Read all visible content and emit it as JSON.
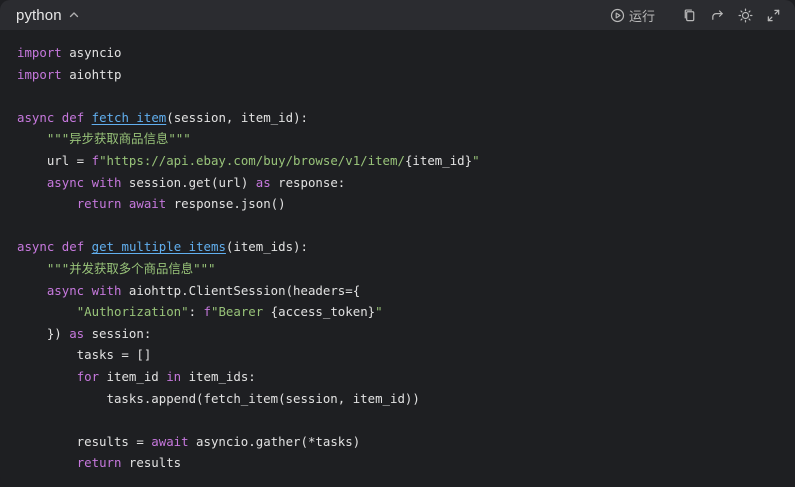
{
  "header": {
    "language": "python",
    "run_label": "运行",
    "icons": [
      "chevron-up-icon",
      "play-circle-icon",
      "copy-icon",
      "redo-arrow-icon",
      "sun-icon",
      "expand-icon"
    ]
  },
  "colors": {
    "background": "#1e1f22",
    "header_background": "#2b2c30",
    "keyword": "#c678dd",
    "function": "#61afef",
    "string": "#98c379",
    "text": "#e2e2e2"
  },
  "code": {
    "lines": [
      [
        {
          "t": "kw",
          "v": "import"
        },
        {
          "t": "plain",
          "v": " asyncio"
        }
      ],
      [
        {
          "t": "kw",
          "v": "import"
        },
        {
          "t": "plain",
          "v": " aiohttp"
        }
      ],
      [],
      [
        {
          "t": "kw",
          "v": "async"
        },
        {
          "t": "plain",
          "v": " "
        },
        {
          "t": "kw",
          "v": "def"
        },
        {
          "t": "plain",
          "v": " "
        },
        {
          "t": "fn",
          "v": "fetch_item"
        },
        {
          "t": "plain",
          "v": "(session, item_id):"
        }
      ],
      [
        {
          "t": "plain",
          "v": "    "
        },
        {
          "t": "str",
          "v": "\"\"\"异步获取商品信息\"\"\""
        }
      ],
      [
        {
          "t": "plain",
          "v": "    url = "
        },
        {
          "t": "kw",
          "v": "f"
        },
        {
          "t": "str",
          "v": "\"https://api.ebay.com/buy/browse/v1/item/"
        },
        {
          "t": "plain",
          "v": "{item_id}"
        },
        {
          "t": "str",
          "v": "\""
        }
      ],
      [
        {
          "t": "plain",
          "v": "    "
        },
        {
          "t": "kw",
          "v": "async"
        },
        {
          "t": "plain",
          "v": " "
        },
        {
          "t": "kw",
          "v": "with"
        },
        {
          "t": "plain",
          "v": " session.get(url) "
        },
        {
          "t": "kw",
          "v": "as"
        },
        {
          "t": "plain",
          "v": " response:"
        }
      ],
      [
        {
          "t": "plain",
          "v": "        "
        },
        {
          "t": "kw",
          "v": "return"
        },
        {
          "t": "plain",
          "v": " "
        },
        {
          "t": "kw",
          "v": "await"
        },
        {
          "t": "plain",
          "v": " response.json()"
        }
      ],
      [],
      [
        {
          "t": "kw",
          "v": "async"
        },
        {
          "t": "plain",
          "v": " "
        },
        {
          "t": "kw",
          "v": "def"
        },
        {
          "t": "plain",
          "v": " "
        },
        {
          "t": "fn",
          "v": "get_multiple_items"
        },
        {
          "t": "plain",
          "v": "(item_ids):"
        }
      ],
      [
        {
          "t": "plain",
          "v": "    "
        },
        {
          "t": "str",
          "v": "\"\"\"并发获取多个商品信息\"\"\""
        }
      ],
      [
        {
          "t": "plain",
          "v": "    "
        },
        {
          "t": "kw",
          "v": "async"
        },
        {
          "t": "plain",
          "v": " "
        },
        {
          "t": "kw",
          "v": "with"
        },
        {
          "t": "plain",
          "v": " aiohttp.ClientSession(headers={"
        }
      ],
      [
        {
          "t": "plain",
          "v": "        "
        },
        {
          "t": "str",
          "v": "\"Authorization\""
        },
        {
          "t": "plain",
          "v": ": "
        },
        {
          "t": "kw",
          "v": "f"
        },
        {
          "t": "str",
          "v": "\"Bearer "
        },
        {
          "t": "plain",
          "v": "{access_token}"
        },
        {
          "t": "str",
          "v": "\""
        }
      ],
      [
        {
          "t": "plain",
          "v": "    }) "
        },
        {
          "t": "kw",
          "v": "as"
        },
        {
          "t": "plain",
          "v": " session:"
        }
      ],
      [
        {
          "t": "plain",
          "v": "        tasks = []"
        }
      ],
      [
        {
          "t": "plain",
          "v": "        "
        },
        {
          "t": "kw",
          "v": "for"
        },
        {
          "t": "plain",
          "v": " item_id "
        },
        {
          "t": "kw",
          "v": "in"
        },
        {
          "t": "plain",
          "v": " item_ids:"
        }
      ],
      [
        {
          "t": "plain",
          "v": "            tasks.append(fetch_item(session, item_id))"
        }
      ],
      [],
      [
        {
          "t": "plain",
          "v": "        results = "
        },
        {
          "t": "kw",
          "v": "await"
        },
        {
          "t": "plain",
          "v": " asyncio.gather(*tasks)"
        }
      ],
      [
        {
          "t": "plain",
          "v": "        "
        },
        {
          "t": "kw",
          "v": "return"
        },
        {
          "t": "plain",
          "v": " results"
        }
      ]
    ]
  }
}
